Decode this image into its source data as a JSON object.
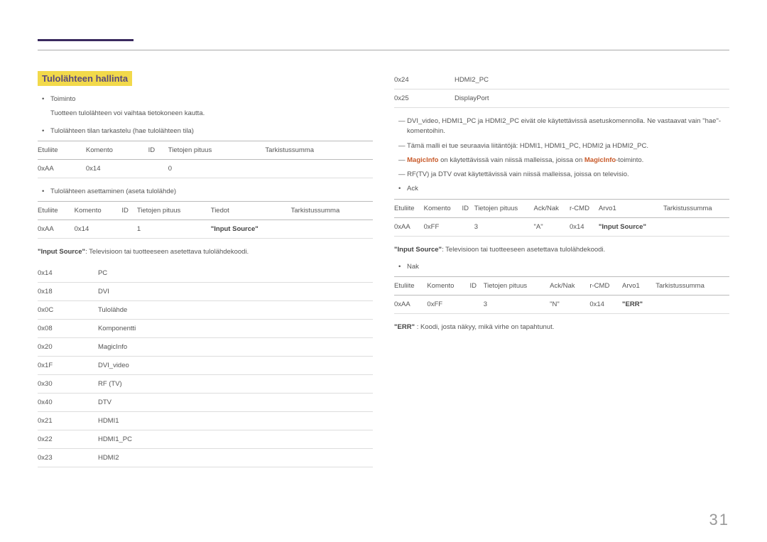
{
  "page_number": "31",
  "section_title": "Tulolähteen hallinta",
  "left": {
    "toiminto_label": "Toiminto",
    "toiminto_desc": "Tuotteen tulolähteen voi vaihtaa tietokoneen kautta.",
    "tarkastelu_label": "Tulolähteen tilan tarkastelu (hae tulolähteen tila)",
    "table1_headers": [
      "Etuliite",
      "Komento",
      "ID",
      "Tietojen pituus",
      "Tarkistussumma"
    ],
    "table1_row": [
      "0xAA",
      "0x14",
      "",
      "0",
      ""
    ],
    "asettaminen_label": "Tulolähteen asettaminen (aseta tulolähde)",
    "table2_headers": [
      "Etuliite",
      "Komento",
      "ID",
      "Tietojen pituus",
      "Tiedot",
      "Tarkistussumma"
    ],
    "table2_row": [
      "0xAA",
      "0x14",
      "",
      "1",
      "\"Input Source\"",
      ""
    ],
    "input_source_desc_prefix": "\"Input Source\"",
    "input_source_desc_text": ": Televisioon tai tuotteeseen asetettava tulolähdekoodi.",
    "codes": [
      {
        "code": "0x14",
        "label": "PC"
      },
      {
        "code": "0x18",
        "label": "DVI"
      },
      {
        "code": "0x0C",
        "label": "Tulolähde"
      },
      {
        "code": "0x08",
        "label": "Komponentti"
      },
      {
        "code": "0x20",
        "label": "MagicInfo"
      },
      {
        "code": "0x1F",
        "label": "DVI_video"
      },
      {
        "code": "0x30",
        "label": "RF (TV)"
      },
      {
        "code": "0x40",
        "label": "DTV"
      },
      {
        "code": "0x21",
        "label": "HDMI1"
      },
      {
        "code": "0x22",
        "label": "HDMI1_PC"
      },
      {
        "code": "0x23",
        "label": "HDMI2"
      }
    ]
  },
  "right": {
    "codes_cont": [
      {
        "code": "0x24",
        "label": "HDMI2_PC"
      },
      {
        "code": "0x25",
        "label": "DisplayPort"
      }
    ],
    "note1": "DVI_video, HDMI1_PC ja HDMI2_PC eivät ole käytettävissä asetuskomennolla. Ne vastaavat vain \"hae\"-komentoihin.",
    "note2": "Tämä malli ei tue seuraavia liitäntöjä: HDMI1, HDMI1_PC, HDMI2 ja HDMI2_PC.",
    "note3_pre": "MagicInfo",
    "note3_mid": " on käytettävissä vain niissä malleissa, joissa on ",
    "note3_hl": "MagicInfo",
    "note3_post": "-toiminto.",
    "note4": "RF(TV) ja DTV ovat käytettävissä vain niissä malleissa, joissa on televisio.",
    "ack_label": "Ack",
    "ack_headers": [
      "Etuliite",
      "Komento",
      "ID",
      "Tietojen pituus",
      "Ack/Nak",
      "r-CMD",
      "Arvo1",
      "Tarkistussumma"
    ],
    "ack_row": [
      "0xAA",
      "0xFF",
      "",
      "3",
      "\"A\"",
      "0x14",
      "\"Input Source\"",
      ""
    ],
    "ack_desc_prefix": "\"Input Source\"",
    "ack_desc_text": ": Televisioon tai tuotteeseen asetettava tulolähdekoodi.",
    "nak_label": "Nak",
    "nak_headers": [
      "Etuliite",
      "Komento",
      "ID",
      "Tietojen pituus",
      "Ack/Nak",
      "r-CMD",
      "Arvo1",
      "Tarkistussumma"
    ],
    "nak_row": [
      "0xAA",
      "0xFF",
      "",
      "3",
      "\"N\"",
      "0x14",
      "\"ERR\"",
      ""
    ],
    "err_prefix": "\"ERR\"",
    "err_text": " : Koodi, josta näkyy, mikä virhe on tapahtunut."
  }
}
